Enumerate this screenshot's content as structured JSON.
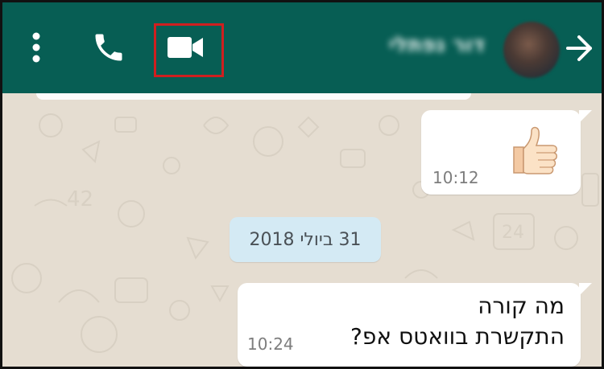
{
  "header": {
    "contact_name": "דור נפתלי",
    "icons": {
      "menu": "more-vert-icon",
      "call": "phone-icon",
      "video": "videocam-icon",
      "back": "arrow-right-icon"
    },
    "colors": {
      "bar": "#075e54",
      "highlight": "#d01f1f"
    }
  },
  "messages": [
    {
      "type": "emoji",
      "emoji": "thumbs-up",
      "time": "10:12"
    },
    {
      "type": "text",
      "lines": [
        "מה קורה",
        "התקשרת בוואטס אפ?"
      ],
      "time": "10:24"
    }
  ],
  "date_divider": "31 ביולי 2018",
  "colors": {
    "chat_bg": "#e5ddd1",
    "bubble": "#ffffff",
    "date_pill": "#d4eaf4"
  }
}
